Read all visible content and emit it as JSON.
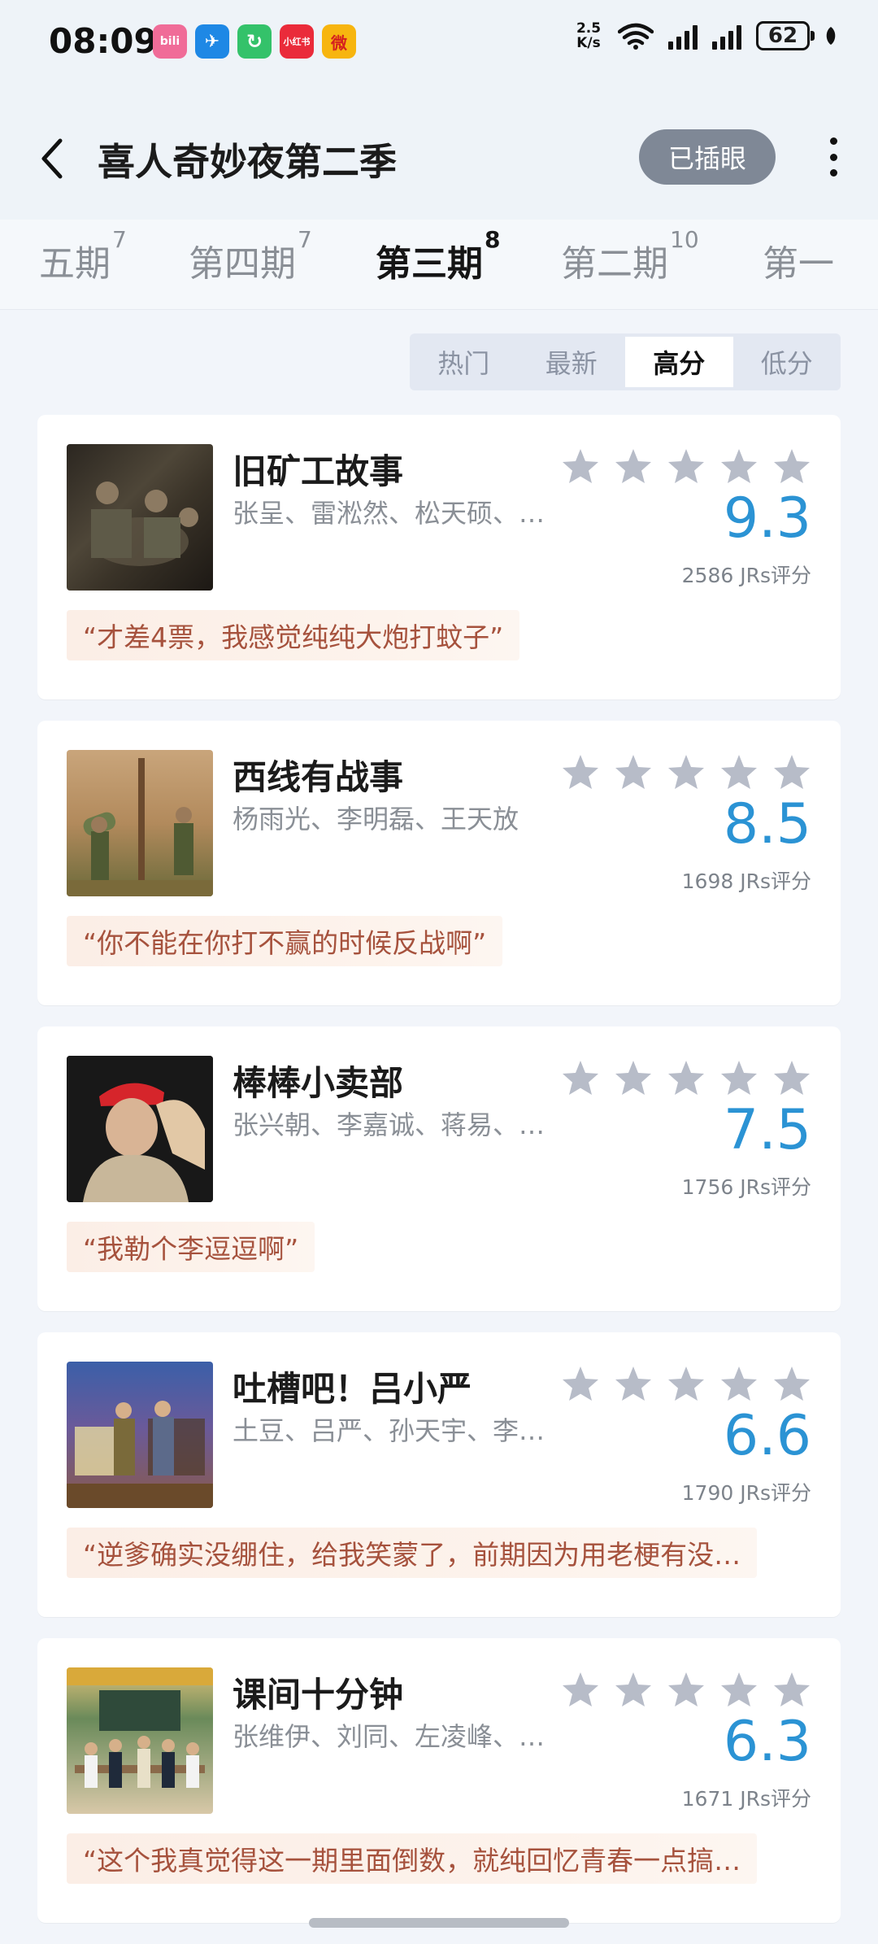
{
  "status_bar": {
    "time": "08:09",
    "network_speed": "2.5 K/s",
    "battery": "62",
    "apps": [
      {
        "icon": "bilibili-icon",
        "label": "bili",
        "color": "#f06c98"
      },
      {
        "icon": "feishu-icon",
        "label": "✈",
        "color": "#1e88e5"
      },
      {
        "icon": "recycle-icon",
        "label": "↻",
        "color": "#34c26a"
      },
      {
        "icon": "xiaohongshu-icon",
        "label": "小红书",
        "color": "#ea2b3a"
      },
      {
        "icon": "weibo-icon",
        "label": "微",
        "color": "#f7b50f"
      }
    ]
  },
  "header": {
    "title": "喜人奇妙夜第二季",
    "watched_button": "已插眼"
  },
  "episode_tabs": [
    {
      "label": "五期",
      "count": "7",
      "active": false
    },
    {
      "label": "第四期",
      "count": "7",
      "active": false
    },
    {
      "label": "第三期",
      "count": "8",
      "active": true
    },
    {
      "label": "第二期",
      "count": "10",
      "active": false
    },
    {
      "label": "第一",
      "count": "",
      "active": false
    }
  ],
  "sort_options": [
    {
      "label": "热门",
      "active": false
    },
    {
      "label": "最新",
      "active": false
    },
    {
      "label": "高分",
      "active": true
    },
    {
      "label": "低分",
      "active": false
    }
  ],
  "shows": [
    {
      "title": "旧矿工故事",
      "cast": "张呈、雷淞然、松天硕、…",
      "score": "9.3",
      "count": "2586 JRs评分",
      "quote": "“才差4票，我感觉纯纯大炮打蚊子”"
    },
    {
      "title": "西线有战事",
      "cast": "杨雨光、李明磊、王天放",
      "score": "8.5",
      "count": "1698 JRs评分",
      "quote": "“你不能在你打不赢的时候反战啊”"
    },
    {
      "title": "棒棒小卖部",
      "cast": "张兴朝、李嘉诚、蒋易、…",
      "score": "7.5",
      "count": "1756 JRs评分",
      "quote": "“我勒个李逗逗啊”"
    },
    {
      "title": "吐槽吧！吕小严",
      "cast": "土豆、吕严、孙天宇、李…",
      "score": "6.6",
      "count": "1790 JRs评分",
      "quote": "“逆爹确实没绷住，给我笑蒙了，前期因为用老梗有没…"
    },
    {
      "title": "课间十分钟",
      "cast": "张维伊、刘同、左凌峰、…",
      "score": "6.3",
      "count": "1671 JRs评分",
      "quote": "“这个我真觉得这一期里面倒数，就纯回忆青春一点搞…"
    }
  ],
  "colors": {
    "score": "#2b93d4",
    "star": "#b7bcc8",
    "quote_text": "#a6523d",
    "pill": "#7f8896"
  }
}
